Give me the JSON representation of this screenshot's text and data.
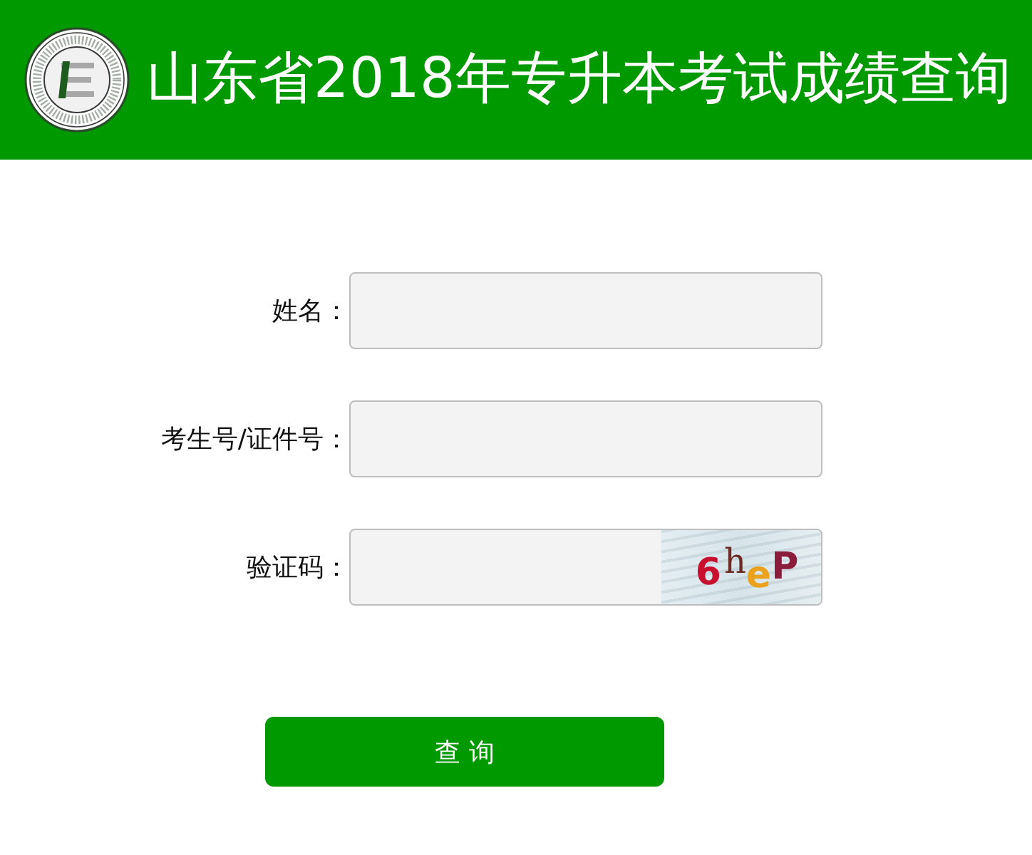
{
  "header": {
    "title": "山东省2018年专升本考试成绩查询"
  },
  "fields": [
    {
      "kind": "text",
      "label": "姓名："
    },
    {
      "kind": "text",
      "label": "考生号/证件号："
    },
    {
      "kind": "captcha",
      "label": "验证码：",
      "captcha": [
        {
          "text": "6",
          "color": "#c8102e"
        },
        {
          "text": "h",
          "color": "#6e2b24"
        },
        {
          "text": "e",
          "color": "#eaa21c"
        },
        {
          "text": "P",
          "color": "#8a1d3c"
        }
      ]
    }
  ],
  "submit": {
    "label": "查 询"
  }
}
